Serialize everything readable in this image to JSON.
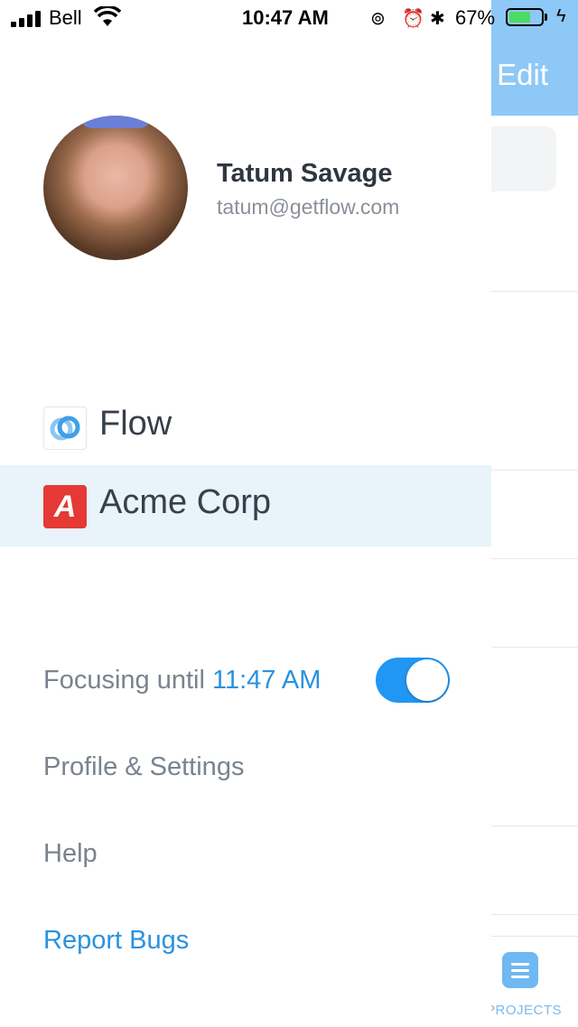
{
  "status_bar": {
    "carrier": "Bell",
    "time": "10:47 AM",
    "battery_percent": "67%",
    "battery_level": 0.67,
    "icons": [
      "signal-icon",
      "wifi-icon",
      "orientation-lock-icon",
      "alarm-icon",
      "bluetooth-icon",
      "battery-icon",
      "charging-icon"
    ]
  },
  "background_app": {
    "edit_label": "Edit",
    "tab_label": "PROJECTS",
    "header_color": "#8ec8f6"
  },
  "profile": {
    "name": "Tatum Savage",
    "email": "tatum@getflow.com"
  },
  "workspaces": [
    {
      "label": "Flow",
      "active": false,
      "icon": "flow-logo-icon"
    },
    {
      "label": "Acme Corp",
      "active": true,
      "icon": "acme-logo-icon",
      "logo_letter": "A"
    }
  ],
  "menu": {
    "focus_label": "Focusing until",
    "focus_time": "11:47 AM",
    "focus_enabled": true,
    "profile_settings": "Profile & Settings",
    "help": "Help",
    "report_bugs": "Report Bugs"
  },
  "colors": {
    "accent": "#2196f3",
    "link": "#2a92df",
    "active_row": "#e8f3fa",
    "acme_red": "#e53935"
  }
}
